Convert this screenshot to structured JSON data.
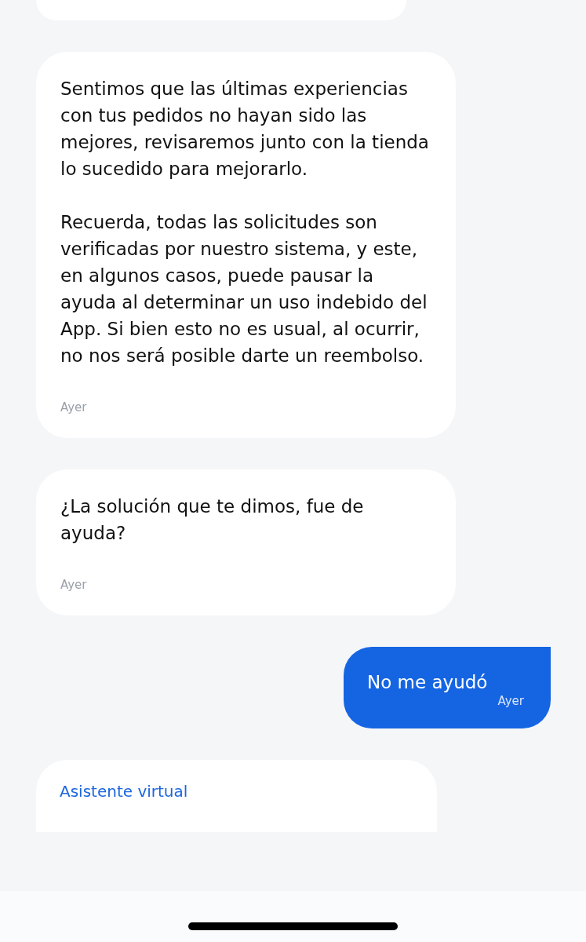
{
  "messages": [
    {
      "kind": "clipped"
    },
    {
      "kind": "agent",
      "paragraphs": [
        "Sentimos que las últimas experiencias con tus pedidos no hayan sido las mejores, revisaremos junto con la tienda lo sucedido para mejorarlo.",
        "Recuerda, todas las solicitudes son verificadas por nuestro sistema, y este, en algunos casos, puede pausar la ayuda al determinar un uso indebido del App. Si bien esto no es usual, al ocurrir, no nos será posible darte un reembolso."
      ],
      "time": "Ayer"
    },
    {
      "kind": "agent",
      "paragraphs": [
        "¿La solución que te dimos, fue de ayuda?"
      ],
      "time": "Ayer"
    },
    {
      "kind": "user",
      "paragraphs": [
        "No me ayudó"
      ],
      "time": "Ayer"
    },
    {
      "kind": "card",
      "title": "Asistente virtual"
    }
  ]
}
